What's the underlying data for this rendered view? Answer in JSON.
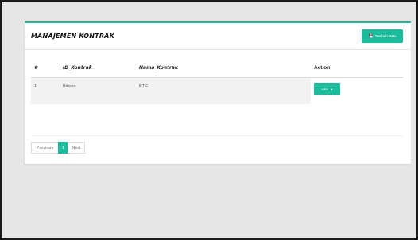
{
  "panel": {
    "title": "MANAJEMEN KONTRAK",
    "add_button": "Tambah Data",
    "add_icon": "floppy-icon"
  },
  "table": {
    "headers": [
      "#",
      "ID_Kontrak",
      "Nama_Kontrak",
      "Action"
    ],
    "rows": [
      {
        "num": "1",
        "id": "Bitcoin",
        "nama": "BTC",
        "action_label": "Aksi"
      }
    ]
  },
  "pagination": {
    "previous": "Previous",
    "current": "1",
    "next": "Next"
  },
  "colors": {
    "accent": "#1abc9c",
    "background": "#e6e6e6"
  }
}
